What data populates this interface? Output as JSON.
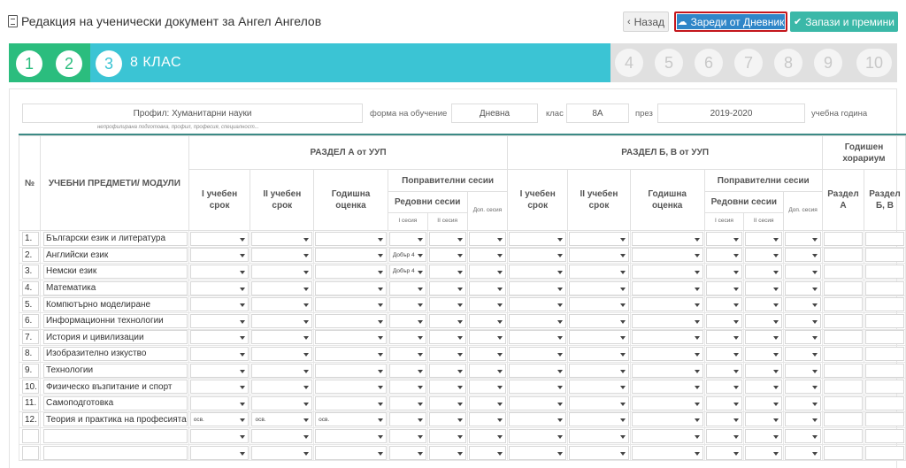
{
  "header": {
    "title": "Редакция на ученически документ за Ангел Ангелов",
    "back_label": "Назад",
    "load_label": "Зареди от Дневник",
    "save_label": "Запази и премини"
  },
  "steps": {
    "done": [
      "1",
      "2"
    ],
    "current": "3",
    "current_label": "8 КЛАС",
    "todo": [
      "4",
      "5",
      "6",
      "7",
      "8",
      "9",
      "10"
    ]
  },
  "form": {
    "profile_value": "Профил: Хуманитарни науки",
    "profile_hint": "непрофилирана подготовка, профил, професия, специалност...",
    "study_form_label": "форма на обучение",
    "study_form_value": "Дневна",
    "class_label": "клас",
    "class_value": "8А",
    "year_label": "през",
    "year_value": "2019-2020",
    "year_suffix": "учебна година"
  },
  "table": {
    "col_no": "№",
    "col_subjects": "УЧЕБНИ ПРЕДМЕТИ/ МОДУЛИ",
    "section_a": "РАЗДЕЛ А от УУП",
    "section_b": "РАЗДЕЛ Б, В от УУП",
    "annual_hours": "Годишен хорариум",
    "term1": "I учебен срок",
    "term2": "II учебен срок",
    "annual_grade": "Годишна оценка",
    "makeup": "Поправителни сесии",
    "regular": "Редовни сесии",
    "extra": "Доп. сесия",
    "session1": "I сесия",
    "session2": "II сесия",
    "hours_a": "Раздел А",
    "hours_b": "Раздел Б, В",
    "rows": [
      {
        "no": "1.",
        "subject": "Български език и литература",
        "t1": "",
        "t2": "",
        "ann": "",
        "s1": ""
      },
      {
        "no": "2.",
        "subject": "Английски език",
        "t1": "",
        "t2": "",
        "ann": "",
        "s1": "Добър 4"
      },
      {
        "no": "3.",
        "subject": "Немски език",
        "t1": "",
        "t2": "",
        "ann": "",
        "s1": "Добър 4"
      },
      {
        "no": "4.",
        "subject": "Математика",
        "t1": "",
        "t2": "",
        "ann": "",
        "s1": ""
      },
      {
        "no": "5.",
        "subject": "Компютърно моделиране",
        "t1": "",
        "t2": "",
        "ann": "",
        "s1": ""
      },
      {
        "no": "6.",
        "subject": "Информационни технологии",
        "t1": "",
        "t2": "",
        "ann": "",
        "s1": ""
      },
      {
        "no": "7.",
        "subject": "История и цивилизации",
        "t1": "",
        "t2": "",
        "ann": "",
        "s1": ""
      },
      {
        "no": "8.",
        "subject": "Изобразително изкуство",
        "t1": "",
        "t2": "",
        "ann": "",
        "s1": ""
      },
      {
        "no": "9.",
        "subject": "Технологии",
        "t1": "",
        "t2": "",
        "ann": "",
        "s1": ""
      },
      {
        "no": "10.",
        "subject": "Физическо възпитание и спорт",
        "t1": "",
        "t2": "",
        "ann": "",
        "s1": ""
      },
      {
        "no": "11.",
        "subject": "Самоподготовка",
        "t1": "",
        "t2": "",
        "ann": "",
        "s1": ""
      },
      {
        "no": "12.",
        "subject": "Теория и практика на професията",
        "t1": "осв.",
        "t2": "осв.",
        "ann": "осв.",
        "s1": ""
      },
      {
        "no": "",
        "subject": "",
        "t1": "",
        "t2": "",
        "ann": "",
        "s1": ""
      },
      {
        "no": "",
        "subject": "",
        "t1": "",
        "t2": "",
        "ann": "",
        "s1": ""
      }
    ]
  }
}
